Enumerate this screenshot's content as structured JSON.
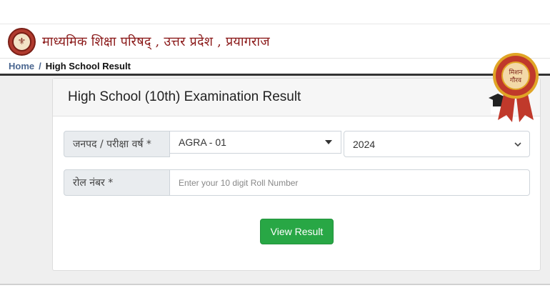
{
  "header": {
    "org_title": "माध्यमिक शिक्षा परिषद् , उत्तर प्रदेश , प्रयागराज",
    "logo_icon": "up-emblem-icon"
  },
  "breadcrumb": {
    "home": "Home",
    "separator": "/",
    "current": "High School Result"
  },
  "card": {
    "title": "High School (10th) Examination Result"
  },
  "form": {
    "district_year_label": "जनपद / परीक्षा वर्ष *",
    "district_value": "AGRA - 01",
    "year_value": "2024",
    "roll_label": "रोल नंबर *",
    "roll_placeholder": "Enter your 10 digit Roll Number",
    "submit_label": "View Result"
  },
  "badge": {
    "text_line1": "मिशन",
    "text_line2": "गौरव"
  },
  "colors": {
    "org_title": "#8b1a1a",
    "breadcrumb_link": "#4a6690",
    "button": "#28a745",
    "badge_red": "#c0392b",
    "badge_gold": "#e0a526"
  }
}
